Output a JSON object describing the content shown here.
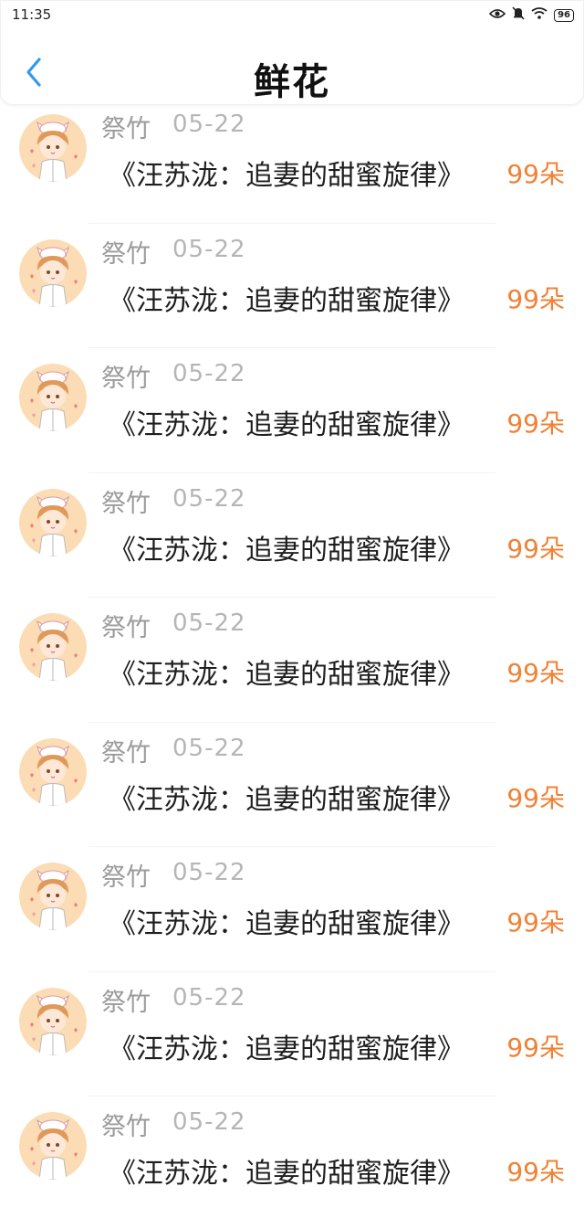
{
  "status_bar": {
    "time": "11:35",
    "battery": "96"
  },
  "header": {
    "title": "鲜花"
  },
  "colors": {
    "accent_blue": "#2f9be8",
    "count_orange": "#f08236"
  },
  "items": [
    {
      "sender": "祭竹",
      "date": "05-22",
      "title": "《汪苏泷：追妻的甜蜜旋律》",
      "count": "99朵"
    },
    {
      "sender": "祭竹",
      "date": "05-22",
      "title": "《汪苏泷：追妻的甜蜜旋律》",
      "count": "99朵"
    },
    {
      "sender": "祭竹",
      "date": "05-22",
      "title": "《汪苏泷：追妻的甜蜜旋律》",
      "count": "99朵"
    },
    {
      "sender": "祭竹",
      "date": "05-22",
      "title": "《汪苏泷：追妻的甜蜜旋律》",
      "count": "99朵"
    },
    {
      "sender": "祭竹",
      "date": "05-22",
      "title": "《汪苏泷：追妻的甜蜜旋律》",
      "count": "99朵"
    },
    {
      "sender": "祭竹",
      "date": "05-22",
      "title": "《汪苏泷：追妻的甜蜜旋律》",
      "count": "99朵"
    },
    {
      "sender": "祭竹",
      "date": "05-22",
      "title": "《汪苏泷：追妻的甜蜜旋律》",
      "count": "99朵"
    },
    {
      "sender": "祭竹",
      "date": "05-22",
      "title": "《汪苏泷：追妻的甜蜜旋律》",
      "count": "99朵"
    },
    {
      "sender": "祭竹",
      "date": "05-22",
      "title": "《汪苏泷：追妻的甜蜜旋律》",
      "count": "99朵"
    }
  ]
}
